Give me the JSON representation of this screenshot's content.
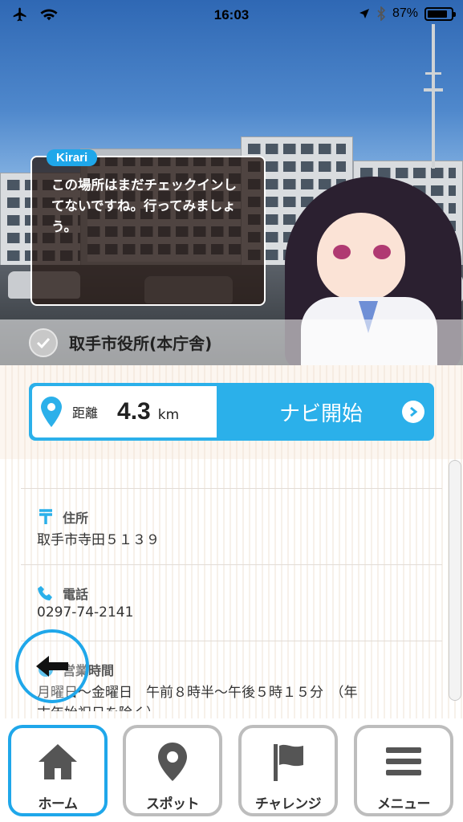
{
  "status_bar": {
    "time": "16:03",
    "battery_percent": "87%",
    "battery_level": 0.87,
    "icons": [
      "airplane-icon",
      "wifi-icon",
      "location-arrow-icon",
      "bluetooth-icon",
      "battery-icon"
    ]
  },
  "bubble": {
    "speaker": "Kirari",
    "line1": "この場所はまだチェックインし",
    "line2": "てないですね。行ってみましょ",
    "line3": "う。"
  },
  "spot": {
    "name": "取手市役所(本庁舎)",
    "checked_in": false
  },
  "navi": {
    "distance_label": "距離",
    "distance_value": "4.3",
    "distance_unit": "km",
    "button_label": "ナビ開始"
  },
  "info": {
    "address": {
      "label": "住所",
      "value": "取手市寺田５１３９"
    },
    "phone": {
      "label": "電話",
      "value": "0297-74-2141"
    },
    "hours": {
      "label": "営業時間",
      "line1": "月曜日～金曜日　午前８時半～午後５時１５分　（年",
      "line2": "末年始祝日を除く）"
    }
  },
  "tabs": [
    {
      "label": "ホーム",
      "icon": "home-icon",
      "active": true
    },
    {
      "label": "スポット",
      "icon": "map-pin-icon",
      "active": false
    },
    {
      "label": "チャレンジ",
      "icon": "flag-icon",
      "active": false
    },
    {
      "label": "メニュー",
      "icon": "menu-icon",
      "active": false
    }
  ],
  "colors": {
    "accent": "#1fa7ea",
    "navi_button": "#2bb0ea",
    "tab_border": "#bdbdbd"
  }
}
